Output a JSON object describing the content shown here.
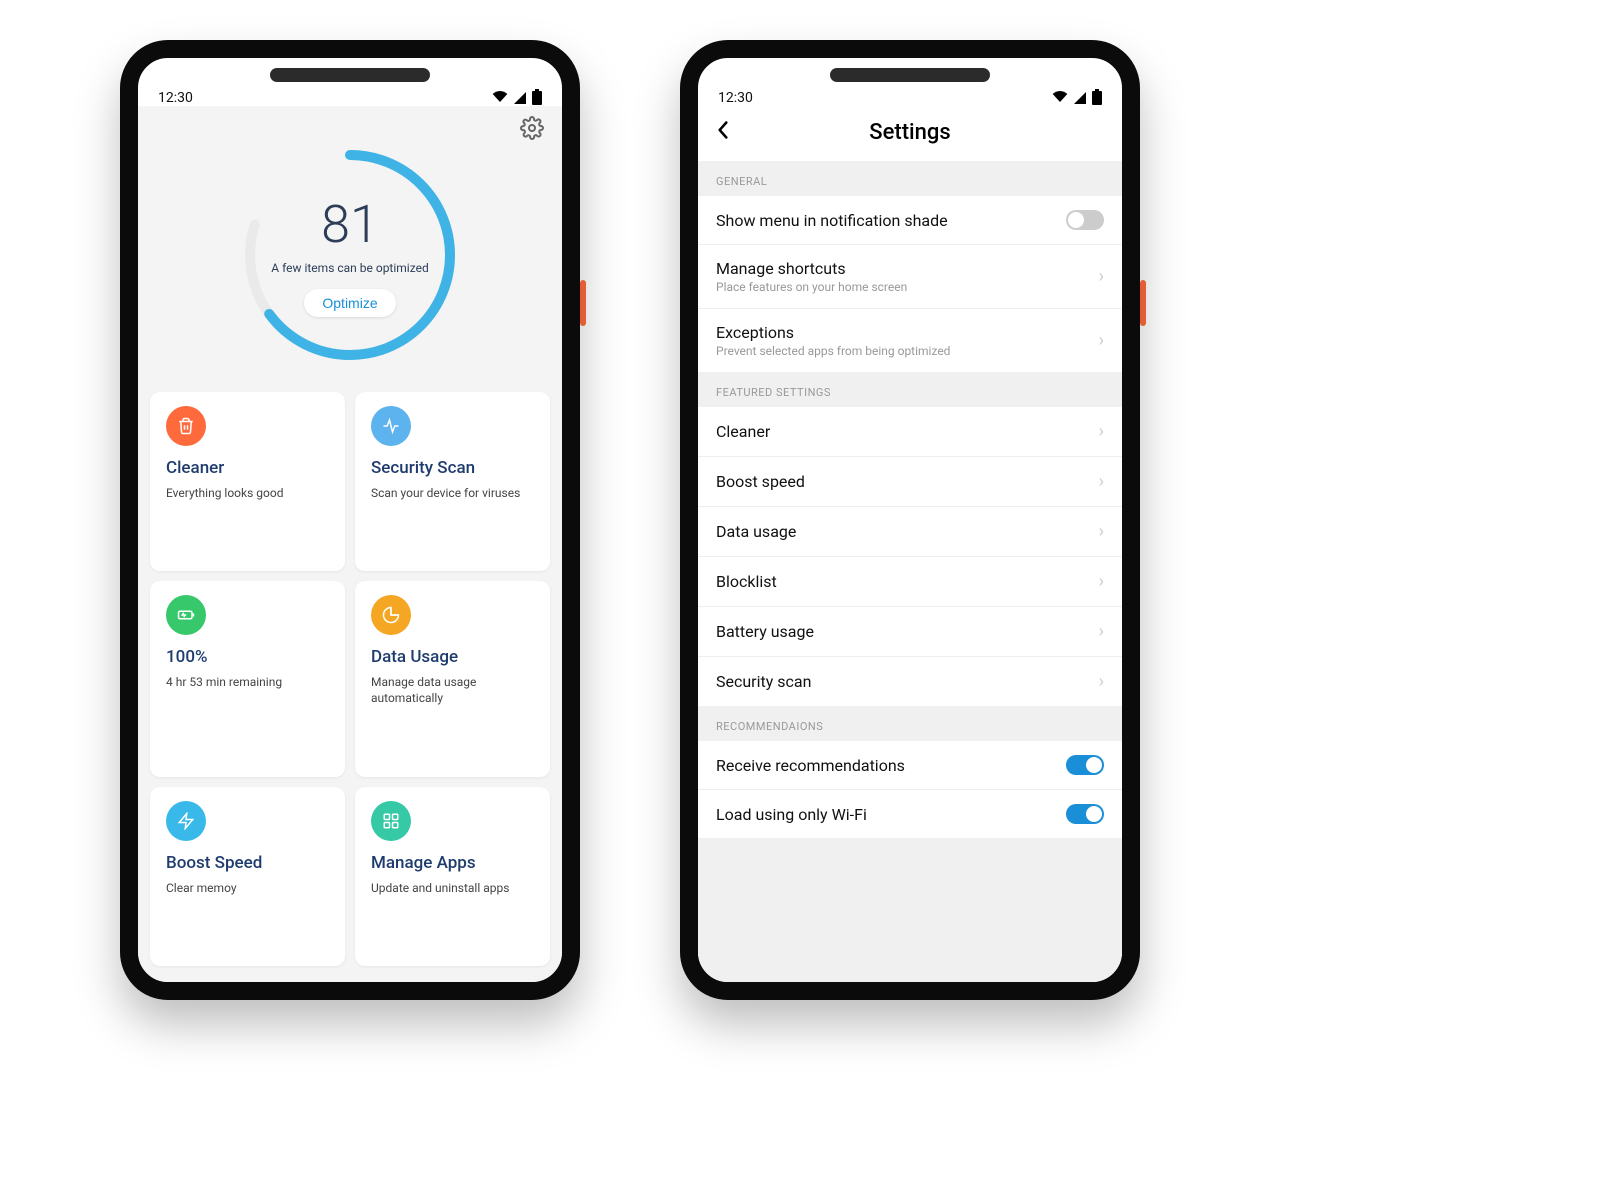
{
  "status_time": "12:30",
  "home": {
    "score": "81",
    "score_msg": "A few items can be optimized",
    "optimize_label": "Optimize",
    "cards": [
      {
        "title": "Cleaner",
        "sub": "Everything looks good",
        "color": "#ff6a3c",
        "icon": "trash"
      },
      {
        "title": "Security Scan",
        "sub": "Scan your device for viruses",
        "color": "#5cb3ee",
        "icon": "pulse"
      },
      {
        "title": "100%",
        "sub": "4 hr 53 min remaining",
        "color": "#37c86b",
        "icon": "charge"
      },
      {
        "title": "Data Usage",
        "sub": "Manage data usage automatically",
        "color": "#f5a623",
        "icon": "pie"
      },
      {
        "title": "Boost Speed",
        "sub": "Clear memoy",
        "color": "#39b9ea",
        "icon": "bolt"
      },
      {
        "title": "Manage Apps",
        "sub": "Update and uninstall apps",
        "color": "#36c9a6",
        "icon": "grid"
      }
    ]
  },
  "settings": {
    "title": "Settings",
    "sections": {
      "general_label": "GENERAL",
      "featured_label": "FEATURED SETTINGS",
      "reco_label": "RECOMMENDAIONS",
      "general": [
        {
          "title": "Show menu in notification shade",
          "sub": "",
          "type": "toggle",
          "on": false
        },
        {
          "title": "Manage shortcuts",
          "sub": "Place features on your home screen",
          "type": "nav"
        },
        {
          "title": "Exceptions",
          "sub": "Prevent selected apps from being optimized",
          "type": "nav"
        }
      ],
      "featured": [
        {
          "title": "Cleaner"
        },
        {
          "title": "Boost speed"
        },
        {
          "title": "Data usage"
        },
        {
          "title": "Blocklist"
        },
        {
          "title": "Battery usage"
        },
        {
          "title": "Security scan"
        }
      ],
      "reco": [
        {
          "title": "Receive recommendations",
          "on": true
        },
        {
          "title": "Load using only Wi-Fi",
          "on": true
        }
      ]
    }
  },
  "colors": {
    "accent": "#1a8fd8",
    "ring": "#3fb3e6"
  }
}
